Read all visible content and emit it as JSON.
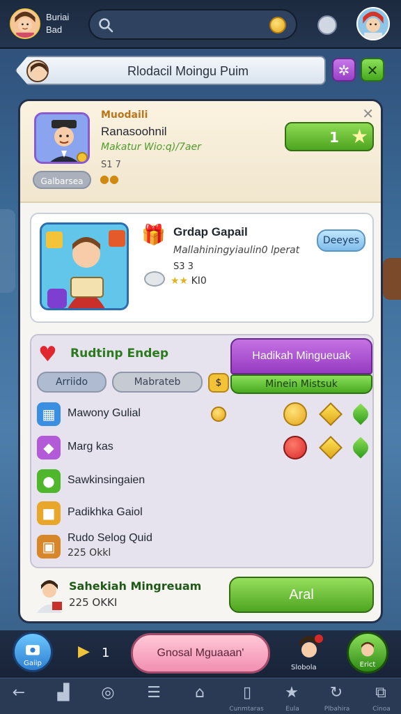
{
  "top": {
    "user_name_1": "Buriai",
    "user_name_2": "Bad"
  },
  "title_bar": {
    "title": "Rlodacil Moingu Puim"
  },
  "profile": {
    "line1": "Muodaili",
    "line2": "Ranasoohnil",
    "line3": "Makatur Wio:q)/7aer",
    "line4": "S1 7",
    "pill": "Galbarsea",
    "level_value": "1"
  },
  "card": {
    "title": "Grdap Gapail",
    "subtitle": "Mallahiningyiaulin0 lperat",
    "line3": "S3 3",
    "line4": "KI0",
    "button": "Deeyes"
  },
  "list": {
    "title": "Rudtinp Endep",
    "tab_a": "Arriido",
    "tab_b": "Mabrateb",
    "promo_top": "Hadikah Mingueuak",
    "promo_bottom": "Minein Mistsuk",
    "rows": [
      {
        "label": "Mawony Gulial"
      },
      {
        "label": "Marg kas"
      },
      {
        "label": "Sawkinsingaien"
      },
      {
        "label": "Padikhka Gaiol"
      },
      {
        "label": "Rudo Selog Quid",
        "sub": "225 Okkl"
      }
    ]
  },
  "footer": {
    "title": "Sahekiah Mingreuam",
    "sub": "225 OKKI",
    "button": "Aral"
  },
  "bottom": {
    "left_label": "Gaiip",
    "play_count": "1",
    "pill": "Gnosal Mguaaan'",
    "avatar_label": "Slobola",
    "right_label": "Erict"
  },
  "nav": {
    "labels": [
      "",
      "",
      "",
      "",
      "",
      "Cunmtaras",
      "Eula",
      "Plbahira",
      "Cinoa"
    ]
  },
  "colors": {
    "accent_green": "#4ea51f",
    "accent_purple": "#963bc2",
    "accent_pink": "#f28fb2",
    "background": "#3b6a96"
  },
  "icons": [
    "search-icon",
    "coin-icon",
    "mic-icon",
    "gear-icon",
    "close-icon",
    "star-icon",
    "heart-icon",
    "play-icon",
    "back-icon",
    "chart-icon",
    "compass-icon",
    "menu-icon",
    "home-icon",
    "book-icon",
    "star-nav-icon",
    "refresh-icon",
    "window-icon"
  ]
}
